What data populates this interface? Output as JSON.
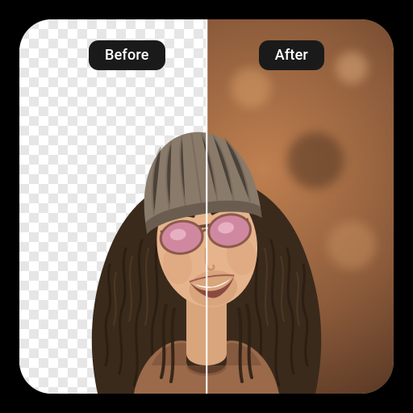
{
  "comparison": {
    "before_label": "Before",
    "after_label": "After"
  }
}
